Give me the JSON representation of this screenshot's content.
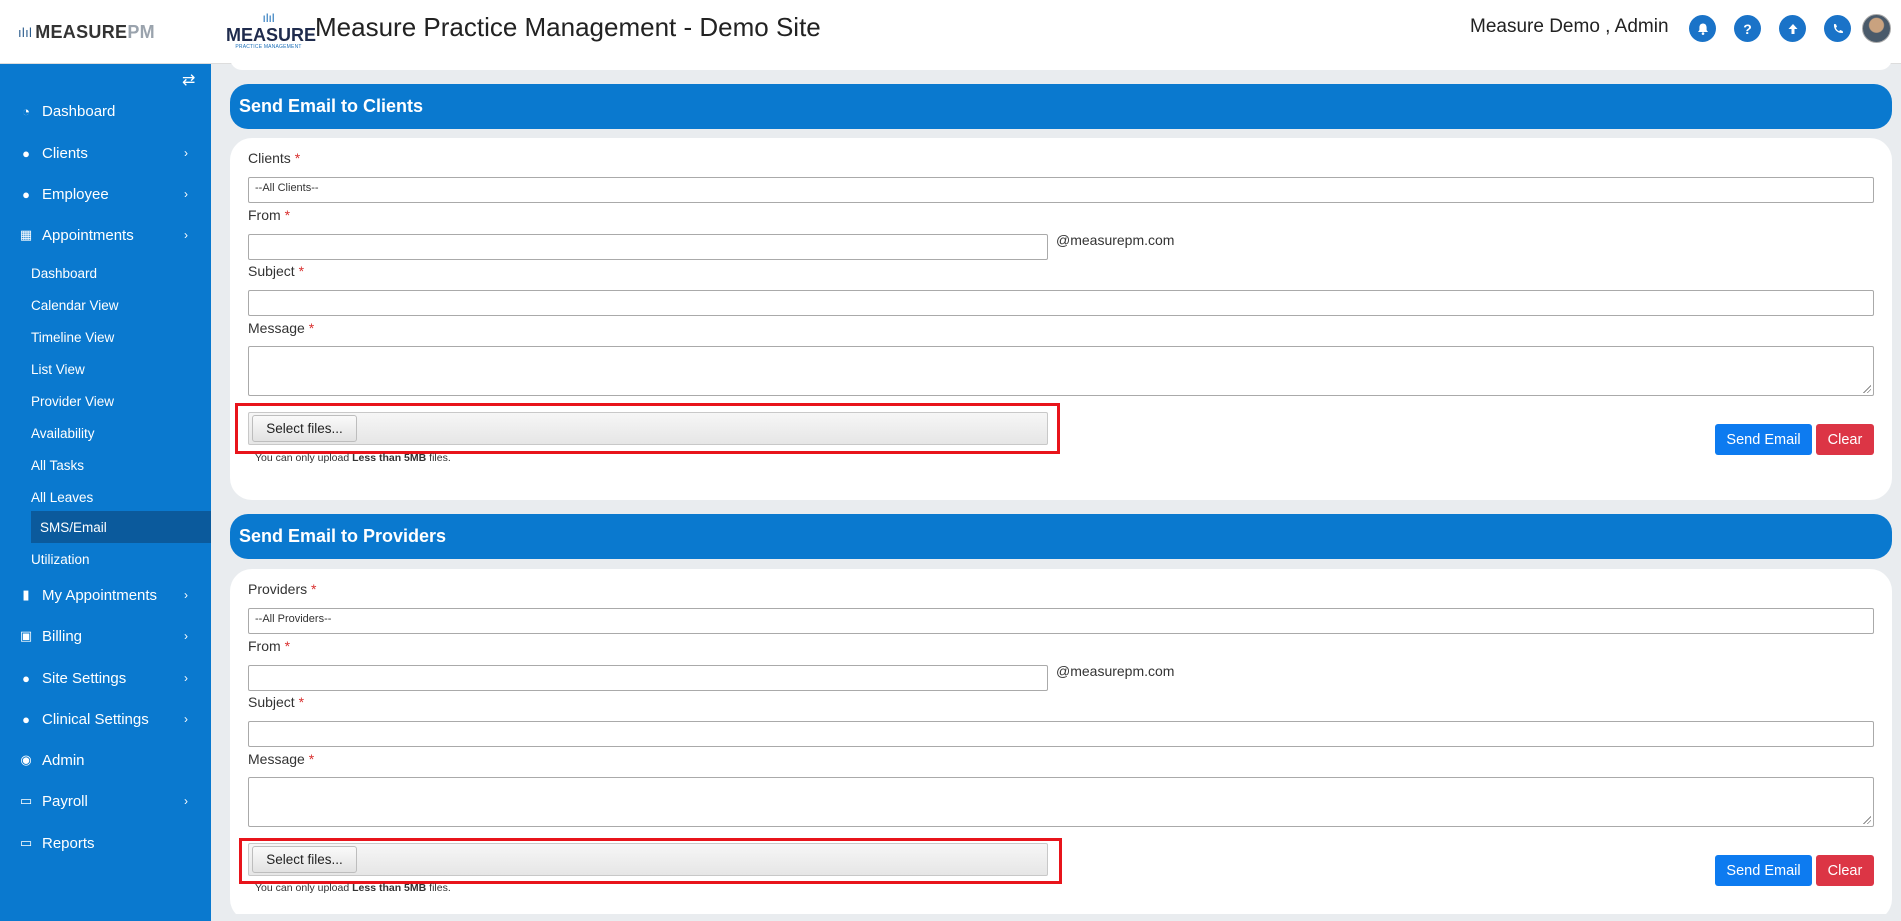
{
  "header": {
    "brand_main": "MEASURE",
    "brand_suffix": "PM",
    "brand_mark": "ılıl",
    "logo_word": "MEASURE",
    "logo_sub": "PRACTICE MANAGEMENT",
    "app_title": "Measure Practice Management - Demo Site",
    "user_name": "Measure Demo , Admin",
    "icons": [
      "bell-icon",
      "help-icon",
      "upload-icon",
      "phone-icon"
    ]
  },
  "sidebar": {
    "collapse_glyph": "⇄",
    "items": [
      {
        "label": "Dashboard",
        "icon": "dashboard-icon",
        "glyph": "◔",
        "chevron": ""
      },
      {
        "label": "Clients",
        "icon": "user-icon",
        "glyph": "●",
        "chevron": "›"
      },
      {
        "label": "Employee",
        "icon": "users-icon",
        "glyph": "●",
        "chevron": "›"
      },
      {
        "label": "Appointments",
        "icon": "calendar-icon",
        "glyph": "▦",
        "chevron": "›"
      },
      {
        "label": "My Appointments",
        "icon": "book-icon",
        "glyph": "▮",
        "chevron": "›"
      },
      {
        "label": "Billing",
        "icon": "money-icon",
        "glyph": "▣",
        "chevron": "›"
      },
      {
        "label": "Site Settings",
        "icon": "user-icon",
        "glyph": "●",
        "chevron": "›"
      },
      {
        "label": "Clinical Settings",
        "icon": "user-icon",
        "glyph": "●",
        "chevron": "›"
      },
      {
        "label": "Admin",
        "icon": "user-circle-icon",
        "glyph": "◉",
        "chevron": ""
      },
      {
        "label": "Payroll",
        "icon": "credit-card-icon",
        "glyph": "▭",
        "chevron": "›"
      },
      {
        "label": "Reports",
        "icon": "credit-card-icon",
        "glyph": "▭",
        "chevron": ""
      }
    ],
    "sub_items": [
      {
        "label": "Dashboard"
      },
      {
        "label": "Calendar View"
      },
      {
        "label": "Timeline View"
      },
      {
        "label": "List View"
      },
      {
        "label": "Provider View"
      },
      {
        "label": "Availability"
      },
      {
        "label": "All Tasks"
      },
      {
        "label": "All Leaves"
      },
      {
        "label": "SMS/Email"
      },
      {
        "label": "Utilization"
      }
    ],
    "active_sub": "SMS/Email"
  },
  "clients_section": {
    "title": "Send Email to Clients",
    "recipient_label": "Clients",
    "recipient_value": "--All Clients--",
    "from_label": "From",
    "from_value": "",
    "domain": "@measurepm.com",
    "subject_label": "Subject",
    "subject_value": "",
    "message_label": "Message",
    "message_value": "",
    "upload_button": "Select files...",
    "hint_prefix": "You can only upload ",
    "hint_bold": "Less than 5MB",
    "hint_suffix": " files.",
    "send_label": "Send Email",
    "clear_label": "Clear",
    "required_mark": "*"
  },
  "providers_section": {
    "title": "Send Email to Providers",
    "recipient_label": "Providers",
    "recipient_value": "--All Providers--",
    "from_label": "From",
    "from_value": "",
    "domain": "@measurepm.com",
    "subject_label": "Subject",
    "subject_value": "",
    "message_label": "Message",
    "message_value": "",
    "upload_button": "Select files...",
    "hint_prefix": "You can only upload ",
    "hint_bold": "Less than 5MB",
    "hint_suffix": " files.",
    "send_label": "Send Email",
    "clear_label": "Clear",
    "required_mark": "*"
  },
  "colors": {
    "primary": "#0a79cf",
    "send_button": "#0d7bf0",
    "clear_button": "#dc3545",
    "highlight": "#e8141b",
    "required": "#d9302f"
  }
}
